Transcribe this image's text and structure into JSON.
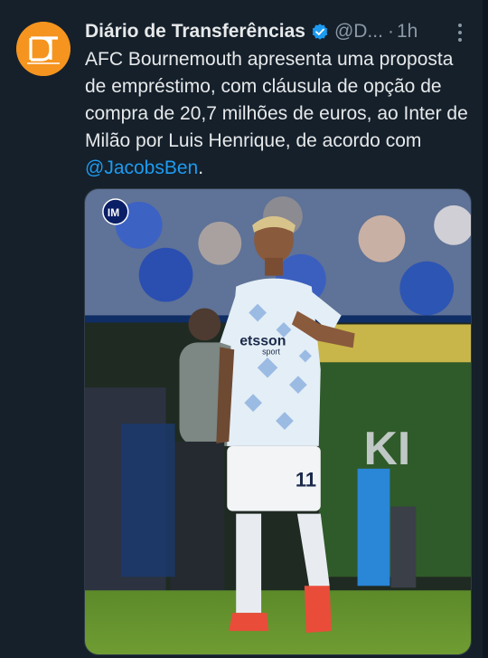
{
  "account": {
    "name": "Diário de Transferências",
    "handle": "@D...",
    "separator": "·",
    "time": "1h",
    "avatar_initials": "DT",
    "avatar_color": "#f5941f",
    "verified_color": "#1d9bf0"
  },
  "tweet": {
    "text": "AFC Bournemouth apresenta uma proposta de empréstimo, com cláusula de opção de compra de 20,7 milhões de euros, ao Inter de Milão por Luis Henrique, de acordo com ",
    "mention": "@JacobsBen",
    "end": "."
  },
  "media": {
    "jersey_sponsor": "etsson",
    "jersey_sponsor_sub": "sport",
    "shirt_number": "11",
    "banner_text": "KI"
  },
  "colors": {
    "background": "#15202b",
    "text": "#e7e9ea",
    "muted": "#8b98a5",
    "link": "#1d9bf0"
  }
}
